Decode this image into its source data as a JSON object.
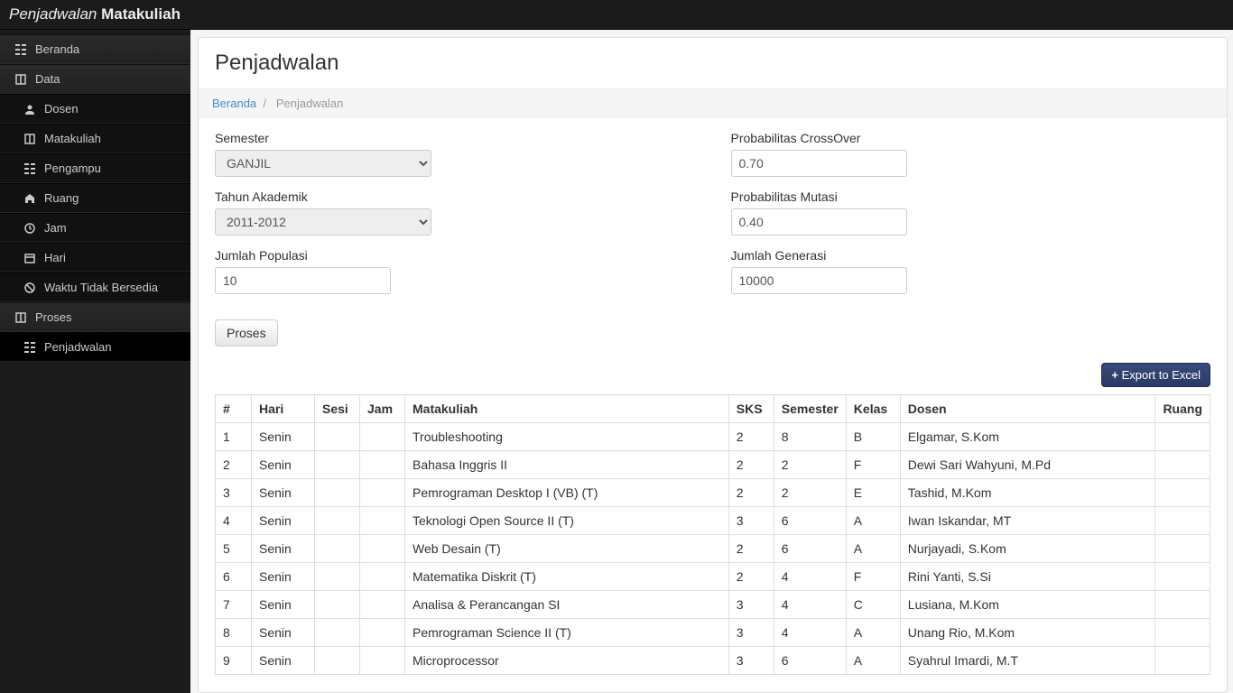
{
  "app": {
    "title_italic": "Penjadwalan",
    "title_bold": "Matakuliah"
  },
  "sidebar": [
    {
      "label": "Beranda",
      "icon": "grid-icon",
      "sub": false
    },
    {
      "label": "Data",
      "icon": "book-icon",
      "sub": false
    },
    {
      "label": "Dosen",
      "icon": "user-icon",
      "sub": true
    },
    {
      "label": "Matakuliah",
      "icon": "book-icon",
      "sub": true
    },
    {
      "label": "Pengampu",
      "icon": "grid-icon",
      "sub": true
    },
    {
      "label": "Ruang",
      "icon": "home-icon",
      "sub": true
    },
    {
      "label": "Jam",
      "icon": "clock-icon",
      "sub": true
    },
    {
      "label": "Hari",
      "icon": "calendar-icon",
      "sub": true
    },
    {
      "label": "Waktu Tidak Bersedia",
      "icon": "ban-icon",
      "sub": true
    },
    {
      "label": "Proses",
      "icon": "book-icon",
      "sub": false
    },
    {
      "label": "Penjadwalan",
      "icon": "grid-icon",
      "sub": true,
      "active": true
    }
  ],
  "page": {
    "title": "Penjadwalan"
  },
  "breadcrumb": {
    "home": "Beranda",
    "sep": "/",
    "current": "Penjadwalan"
  },
  "form": {
    "semester_label": "Semester",
    "semester_value": "GANJIL",
    "tahun_label": "Tahun Akademik",
    "tahun_value": "2011-2012",
    "populasi_label": "Jumlah Populasi",
    "populasi_value": "10",
    "crossover_label": "Probabilitas CrossOver",
    "crossover_value": "0.70",
    "mutasi_label": "Probabilitas Mutasi",
    "mutasi_value": "0.40",
    "generasi_label": "Jumlah Generasi",
    "generasi_value": "10000",
    "proses_btn": "Proses",
    "export_btn": "Export to Excel"
  },
  "table": {
    "headers": [
      "#",
      "Hari",
      "Sesi",
      "Jam",
      "Matakuliah",
      "SKS",
      "Semester",
      "Kelas",
      "Dosen",
      "Ruang"
    ],
    "rows": [
      {
        "n": "1",
        "hari": "Senin",
        "sesi": "",
        "jam": "",
        "mk": "Troubleshooting",
        "sks": "2",
        "sem": "8",
        "kelas": "B",
        "dosen": "Elgamar, S.Kom",
        "ruang": ""
      },
      {
        "n": "2",
        "hari": "Senin",
        "sesi": "",
        "jam": "",
        "mk": "Bahasa Inggris II",
        "sks": "2",
        "sem": "2",
        "kelas": "F",
        "dosen": "Dewi Sari Wahyuni, M.Pd",
        "ruang": ""
      },
      {
        "n": "3",
        "hari": "Senin",
        "sesi": "",
        "jam": "",
        "mk": "Pemrograman Desktop I (VB) (T)",
        "sks": "2",
        "sem": "2",
        "kelas": "E",
        "dosen": "Tashid, M.Kom",
        "ruang": ""
      },
      {
        "n": "4",
        "hari": "Senin",
        "sesi": "",
        "jam": "",
        "mk": "Teknologi Open Source II (T)",
        "sks": "3",
        "sem": "6",
        "kelas": "A",
        "dosen": "Iwan Iskandar, MT",
        "ruang": ""
      },
      {
        "n": "5",
        "hari": "Senin",
        "sesi": "",
        "jam": "",
        "mk": "Web Desain (T)",
        "sks": "2",
        "sem": "6",
        "kelas": "A",
        "dosen": "Nurjayadi, S.Kom",
        "ruang": ""
      },
      {
        "n": "6",
        "hari": "Senin",
        "sesi": "",
        "jam": "",
        "mk": "Matematika Diskrit (T)",
        "sks": "2",
        "sem": "4",
        "kelas": "F",
        "dosen": "Rini Yanti, S.Si",
        "ruang": ""
      },
      {
        "n": "7",
        "hari": "Senin",
        "sesi": "",
        "jam": "",
        "mk": "Analisa & Perancangan SI",
        "sks": "3",
        "sem": "4",
        "kelas": "C",
        "dosen": "Lusiana, M.Kom",
        "ruang": ""
      },
      {
        "n": "8",
        "hari": "Senin",
        "sesi": "",
        "jam": "",
        "mk": "Pemrograman Science II (T)",
        "sks": "3",
        "sem": "4",
        "kelas": "A",
        "dosen": "Unang Rio, M.Kom",
        "ruang": ""
      },
      {
        "n": "9",
        "hari": "Senin",
        "sesi": "",
        "jam": "",
        "mk": "Microprocessor",
        "sks": "3",
        "sem": "6",
        "kelas": "A",
        "dosen": "Syahrul Imardi, M.T",
        "ruang": ""
      }
    ]
  }
}
